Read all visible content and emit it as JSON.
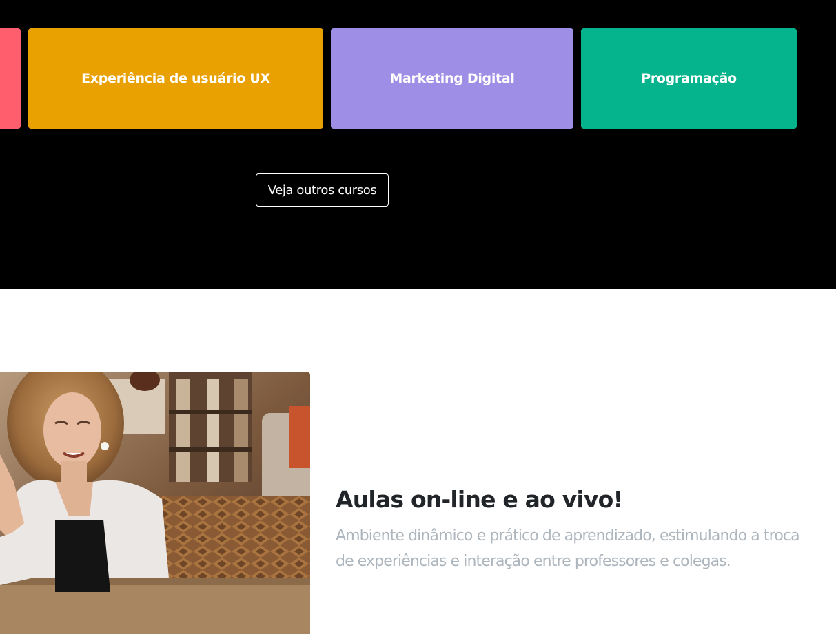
{
  "courses": {
    "items": [
      {
        "label": "",
        "color": "#ff5f6d"
      },
      {
        "label": "Experiência de usuário UX",
        "color": "#e8a100"
      },
      {
        "label": "Marketing Digital",
        "color": "#9e8ee5"
      },
      {
        "label": "Programação",
        "color": "#05b38c"
      }
    ],
    "more_label": "Veja outros cursos"
  },
  "feature": {
    "title": "Aulas on-line e ao vivo!",
    "text": "Ambiente dinâmico e prático de aprendizado, estimulando a troca de experiências e interação entre professores e colegas."
  },
  "colors": {
    "dark_background": "#000000",
    "page_background": "#ffffff",
    "title": "#212529",
    "muted_text": "#adb5bd"
  }
}
